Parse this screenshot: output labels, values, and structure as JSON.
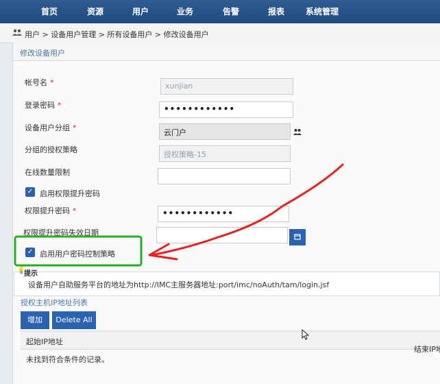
{
  "nav": {
    "items": [
      "首页",
      "资源",
      "用户",
      "业务",
      "告警",
      "报表",
      "系统管理"
    ]
  },
  "breadcrumb": {
    "text": "用户 > 设备用户管理 > 所有设备用户 > 修改设备用户"
  },
  "panel": {
    "title": "修改设备用户"
  },
  "form": {
    "account": {
      "label": "帐号名",
      "required": "*",
      "value": "xunjian"
    },
    "password": {
      "label": "登录密码",
      "required": "*",
      "value": "••••••••••••"
    },
    "group": {
      "label": "设备用户分组",
      "required": "*",
      "value": "云门户"
    },
    "group_policy": {
      "label": "分组的授权策略",
      "value": "授权策略-15"
    },
    "online_limit": {
      "label": "在线数量限制",
      "value": ""
    },
    "enable_priv_pwd": {
      "label": "启用权限提升密码",
      "checked": true
    },
    "priv_pwd": {
      "label": "权限提升密码",
      "required": "*",
      "value": "••••••••••••"
    },
    "priv_pwd_expiry": {
      "label": "权限提升密码失效日期",
      "value": ""
    },
    "enable_pwd_policy": {
      "label": "启用用户密码控制策略",
      "checked": true
    }
  },
  "hint": {
    "title": "提示",
    "text": "设备用户自助服务平台的地址为http://IMC主服务器地址:port/imc/noAuth/tam/login.jsf"
  },
  "ip_list": {
    "title": "授权主机IP地址列表",
    "add_label": "增加",
    "delete_all_label": "Delete All",
    "columns": [
      "起始IP地址",
      "结束IP地"
    ],
    "empty_text": "未找到符合条件的记录。"
  },
  "colors": {
    "nav_bg": "#1f4a7e",
    "accent": "#2b63b0",
    "annotation_box": "#22b022",
    "annotation_arrow": "#e8201e"
  }
}
